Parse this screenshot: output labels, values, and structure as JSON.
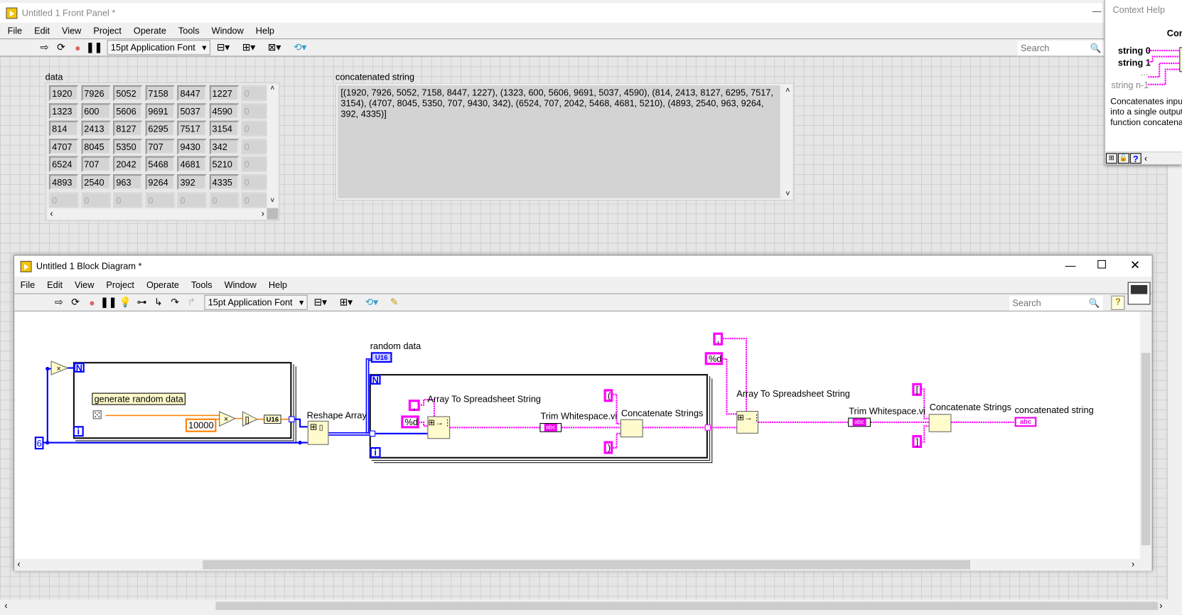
{
  "front_panel": {
    "title": "Untitled 1 Front Panel *",
    "menu": [
      "File",
      "Edit",
      "View",
      "Project",
      "Operate",
      "Tools",
      "Window",
      "Help"
    ],
    "font": "15pt Application Font",
    "search_placeholder": "Search",
    "data_label": "data",
    "data": [
      [
        "1920",
        "7926",
        "5052",
        "7158",
        "8447",
        "1227",
        "0"
      ],
      [
        "1323",
        "600",
        "5606",
        "9691",
        "5037",
        "4590",
        "0"
      ],
      [
        "814",
        "2413",
        "8127",
        "6295",
        "7517",
        "3154",
        "0"
      ],
      [
        "4707",
        "8045",
        "5350",
        "707",
        "9430",
        "342",
        "0"
      ],
      [
        "6524",
        "707",
        "2042",
        "5468",
        "4681",
        "5210",
        "0"
      ],
      [
        "4893",
        "2540",
        "963",
        "9264",
        "392",
        "4335",
        "0"
      ],
      [
        "0",
        "0",
        "0",
        "0",
        "0",
        "0",
        "0"
      ]
    ],
    "string_label": "concatenated string",
    "string_value": "[(1920, 7926, 5052, 7158, 8447, 1227), (1323, 600, 5606, 9691, 5037, 4590), (814, 2413, 8127, 6295, 7517, 3154), (4707, 8045, 5350, 707, 9430, 342), (6524, 707, 2042, 5468, 4681, 5210), (4893, 2540, 963, 9264, 392, 4335)]"
  },
  "context_help": {
    "title": "Context Help",
    "heading": "Con",
    "terms": [
      "string 0",
      "string 1",
      "...",
      "string n-1"
    ],
    "description": "Concatenates input\ninto a single output\nfunction concatena"
  },
  "block_diagram": {
    "title": "Untitled 1 Block Diagram *",
    "menu": [
      "File",
      "Edit",
      "View",
      "Project",
      "Operate",
      "Tools",
      "Window",
      "Help"
    ],
    "font": "15pt Application Font",
    "search_placeholder": "Search",
    "labels": {
      "generate": "generate random data",
      "constant_10000": "10000",
      "constant_6": "6",
      "u16": "U16",
      "reshape": "Reshape Array",
      "random_data": "random data",
      "random_data_type": "U16",
      "a2s_1": "Array To Spreadsheet String",
      "trim_1": "Trim Whitespace.vi",
      "concat_1": "Concatenate Strings",
      "a2s_2": "Array To Spreadsheet String",
      "trim_2": "Trim Whitespace.vi",
      "concat_2": "Concatenate Strings",
      "out": "concatenated string",
      "abc": "abc",
      "N": "N",
      "i": "i"
    },
    "constants": {
      "comma": ",",
      "fmt": "%d",
      "open_paren": "(",
      "close_paren": ")",
      "open_bracket": "[",
      "close_bracket": "]"
    }
  },
  "colors": {
    "string_wire": "#ff00ff",
    "numeric_wire": "#0000ff",
    "double_wire": "#ff8000",
    "node_fill": "#fffbcc"
  }
}
